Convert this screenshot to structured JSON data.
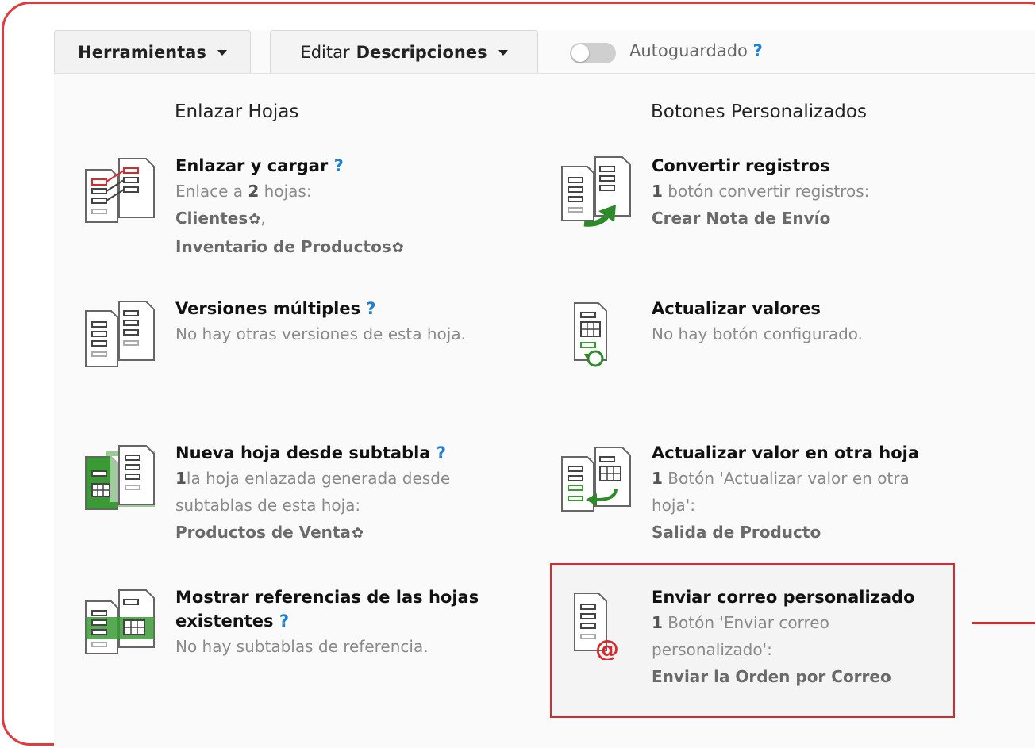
{
  "toolbar": {
    "tools_label": "Herramientas",
    "edit_prefix": "Editar",
    "edit_bold": "Descripciones",
    "autosave_label": "Autoguardado",
    "help": "?"
  },
  "left_section": {
    "title": "Enlazar Hojas",
    "items": [
      {
        "title": "Enlazar y cargar",
        "l1_pre": "Enlace a ",
        "l1_num": "2",
        "l1_post": " hojas:",
        "l2": "Clientes",
        "l3": "Inventario de Productos"
      },
      {
        "title": "Versiones múltiples",
        "l1": "No hay otras versiones de esta hoja."
      },
      {
        "title": "Nueva hoja desde subtabla",
        "l1_num": "1",
        "l1_post": "la hoja enlazada generada desde",
        "l2": "subtablas de esta hoja:",
        "l3": "Productos de Venta"
      },
      {
        "title_a": "Mostrar referencias de las hojas",
        "title_b": "existentes",
        "l1": "No hay subtablas de referencia."
      }
    ]
  },
  "right_section": {
    "title": "Botones Personalizados",
    "items": [
      {
        "title": "Convertir registros",
        "l1_num": "1",
        "l1_post": " botón convertir registros:",
        "l2": "Crear Nota de Envío"
      },
      {
        "title": "Actualizar valores",
        "l1": "No hay botón configurado."
      },
      {
        "title": "Actualizar valor en otra hoja",
        "l1_num": "1",
        "l1_post": " Botón 'Actualizar valor en otra",
        "l2": "hoja':",
        "l3": "Salida de Producto"
      },
      {
        "title": "Enviar correo personalizado",
        "l1_num": "1",
        "l1_post": " Botón 'Enviar correo",
        "l2": "personalizado':",
        "l3": "Enviar la Orden por Correo"
      }
    ]
  },
  "colors": {
    "accent_red": "#e0393e",
    "help_blue": "#1f7fd0",
    "icon_green": "#3a9b35"
  }
}
